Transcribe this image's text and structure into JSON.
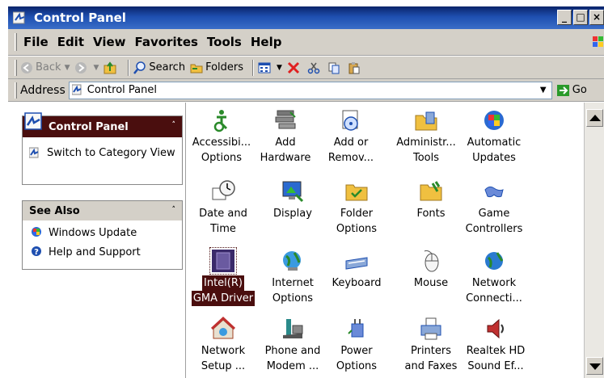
{
  "window": {
    "title": "Control Panel",
    "minimize_label": "_",
    "maximize_label": "□",
    "close_label": "×"
  },
  "menu": [
    {
      "label": "File"
    },
    {
      "label": "Edit"
    },
    {
      "label": "View"
    },
    {
      "label": "Favorites"
    },
    {
      "label": "Tools"
    },
    {
      "label": "Help"
    }
  ],
  "toolbar": {
    "back_label": "Back",
    "search_label": "Search",
    "folders_label": "Folders"
  },
  "address": {
    "label": "Address",
    "value": "Control Panel",
    "go_label": "Go"
  },
  "task_pane": {
    "control_panel_header": "Control Panel",
    "switch_view_link": "Switch to Category View",
    "see_also_header": "See Also",
    "see_also_links": [
      {
        "label": "Windows Update"
      },
      {
        "label": "Help and Support"
      }
    ]
  },
  "items": [
    {
      "line1": "Accessibi...",
      "line2": "Options",
      "icon": "accessibility-icon"
    },
    {
      "line1": "Add",
      "line2": "Hardware",
      "icon": "add-hardware-icon"
    },
    {
      "line1": "Add or",
      "line2": "Remov...",
      "icon": "add-remove-programs-icon"
    },
    {
      "line1": "Administr...",
      "line2": "Tools",
      "icon": "administrative-tools-icon"
    },
    {
      "line1": "Automatic",
      "line2": "Updates",
      "icon": "automatic-updates-icon"
    },
    {
      "line1": "Date and",
      "line2": "Time",
      "icon": "date-time-icon"
    },
    {
      "line1": "Display",
      "line2": "",
      "icon": "display-icon"
    },
    {
      "line1": "Folder",
      "line2": "Options",
      "icon": "folder-options-icon"
    },
    {
      "line1": "Fonts",
      "line2": "",
      "icon": "fonts-icon"
    },
    {
      "line1": "Game",
      "line2": "Controllers",
      "icon": "game-controllers-icon"
    },
    {
      "line1": "Intel(R)",
      "line2": "GMA Driver",
      "icon": "intel-gma-driver-icon"
    },
    {
      "line1": "Internet",
      "line2": "Options",
      "icon": "internet-options-icon"
    },
    {
      "line1": "Keyboard",
      "line2": "",
      "icon": "keyboard-icon"
    },
    {
      "line1": "Mouse",
      "line2": "",
      "icon": "mouse-icon"
    },
    {
      "line1": "Network",
      "line2": "Connecti...",
      "icon": "network-connections-icon"
    },
    {
      "line1": "Network",
      "line2": "Setup ...",
      "icon": "network-setup-icon"
    },
    {
      "line1": "Phone and",
      "line2": "Modem ...",
      "icon": "phone-modem-icon"
    },
    {
      "line1": "Power",
      "line2": "Options",
      "icon": "power-options-icon"
    },
    {
      "line1": "Printers",
      "line2": "and Faxes",
      "icon": "printers-faxes-icon"
    },
    {
      "line1": "Realtek HD",
      "line2": "Sound Ef...",
      "icon": "realtek-sound-icon"
    }
  ],
  "colors": {
    "title_bar": "#0a246a",
    "selection": "#4a0e0e",
    "chrome": "#d4d0c8"
  }
}
